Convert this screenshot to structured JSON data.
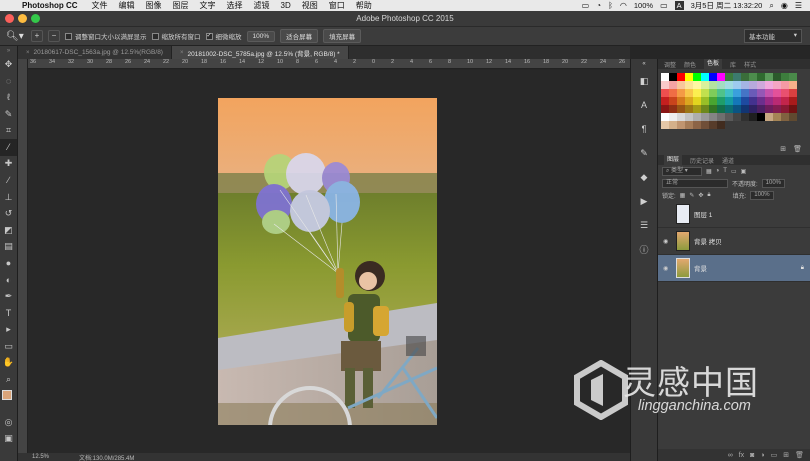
{
  "menubar": {
    "app_name": "Photoshop CC",
    "items": [
      "文件",
      "编辑",
      "图像",
      "图层",
      "文字",
      "选择",
      "滤镜",
      "3D",
      "视图",
      "窗口",
      "帮助"
    ],
    "battery": "100%",
    "input_label": "A",
    "datetime": "3月5日 周二  13:32:20"
  },
  "titlebar": {
    "title": "Adobe Photoshop CC 2015"
  },
  "options": {
    "resize_windows": "调整窗口大小以满屏显示",
    "zoom_all": "缩放所有窗口",
    "scrubby_zoom": "细微缩放",
    "btn_100": "100%",
    "fit_screen": "适合屏幕",
    "fill_screen": "填充屏幕",
    "workspace": "基本功能"
  },
  "tabs": [
    {
      "label": "20180617-DSC_1563a.jpg @ 12.5%(RGB/8)",
      "active": false
    },
    {
      "label": "20181002-DSC_5785a.jpg @ 12.5% (背景, RGB/8) *",
      "active": true
    }
  ],
  "ruler": {
    "ticks": [
      "36",
      "34",
      "32",
      "30",
      "28",
      "26",
      "24",
      "22",
      "20",
      "18",
      "16",
      "14",
      "12",
      "10",
      "8",
      "6",
      "4",
      "2",
      "0",
      "2",
      "4",
      "6",
      "8",
      "10",
      "12",
      "14",
      "16",
      "18",
      "20",
      "22",
      "24",
      "26"
    ]
  },
  "status": {
    "zoom": "12.5%",
    "doc_info": "文档:130.0M/285.4M"
  },
  "panel_top": {
    "tabs": [
      "调整",
      "颜色",
      "色板",
      "库",
      "样式"
    ],
    "active_index": 2
  },
  "swatch_colors": [
    "#ffffff",
    "#000000",
    "#ff0000",
    "#ffff00",
    "#00ff00",
    "#00ffff",
    "#0000ff",
    "#ff00ff",
    "#3c7a3c",
    "#3c7a6e",
    "#3a6e3a",
    "#4c8c4c",
    "#2f6a2f",
    "#5a9a5a",
    "#2b5a2b",
    "#3d7d3d",
    "#4a8a4a",
    "#f9c9c9",
    "#f4a4a4",
    "#f7c79b",
    "#fbe59a",
    "#fff7a3",
    "#d9f19b",
    "#b4e3a0",
    "#a3dcc2",
    "#a2dbe2",
    "#9ecbef",
    "#a4b4e4",
    "#b7a9dc",
    "#cfa8db",
    "#f1a9dd",
    "#f4a5c3",
    "#f59aa4",
    "#f7b08a",
    "#ee4f4f",
    "#ef6d45",
    "#f49a45",
    "#f8c74a",
    "#fbef50",
    "#c1e04e",
    "#7fcc5a",
    "#4fc28a",
    "#41c0c6",
    "#3aa0dd",
    "#4574c6",
    "#6a5bb8",
    "#9557b6",
    "#c552ad",
    "#e3519a",
    "#e9506f",
    "#d94040",
    "#c41f1f",
    "#c9441c",
    "#d4781d",
    "#dba61f",
    "#e3d51f",
    "#99bf27",
    "#49a531",
    "#1f9d6a",
    "#159ca4",
    "#1477b9",
    "#1e4aa0",
    "#43328f",
    "#6c2f8d",
    "#9a2a85",
    "#b92a73",
    "#c2254b",
    "#a81b1b",
    "#8a1515",
    "#8f2f14",
    "#975414",
    "#9c7616",
    "#a39a17",
    "#6d881d",
    "#337523",
    "#136f4b",
    "#0c6e74",
    "#0b5483",
    "#123572",
    "#2e2264",
    "#4c2064",
    "#6d1d5d",
    "#831d51",
    "#891934",
    "#701212",
    "#ffffff",
    "#eeeeee",
    "#d9d9d9",
    "#c4c4c4",
    "#aeaeae",
    "#999999",
    "#848484",
    "#6f6f6f",
    "#5a5a5a",
    "#454545",
    "#303030",
    "#1f1f1f",
    "#000000",
    "#c8a882",
    "#a58556",
    "#806240",
    "#604a30",
    "#e6c8a8",
    "#d4b08a",
    "#c09570",
    "#a67c58",
    "#8c6446",
    "#704f38",
    "#573c2a",
    "#412c1f"
  ],
  "layers_panel": {
    "tabs": [
      "图层",
      "历史记录",
      "通道"
    ],
    "active_index": 0,
    "filter_kind": "类型",
    "blend_mode": "正常",
    "opacity_label": "不透明度:",
    "opacity_value": "100%",
    "lock_label": "锁定:",
    "fill_label": "填充:",
    "fill_value": "100%",
    "layers": [
      {
        "name": "图层 1",
        "visible": false,
        "selected": false,
        "locked": false
      },
      {
        "name": "背景 拷贝",
        "visible": true,
        "selected": false,
        "locked": false
      },
      {
        "name": "背景",
        "visible": true,
        "selected": true,
        "locked": true
      }
    ]
  },
  "watermark": {
    "cn": "灵感中国",
    "en": "lingganchina.com"
  }
}
